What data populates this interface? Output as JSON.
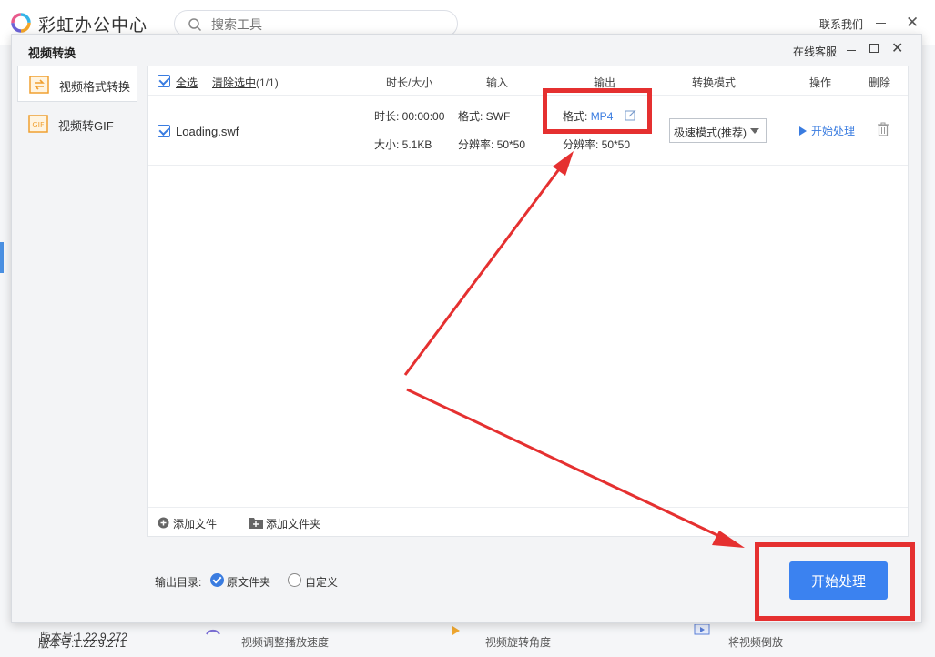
{
  "background_app": {
    "title": "彩虹办公中心",
    "search_placeholder": "搜索工具",
    "contact_label": "联系我们",
    "version": "版本号:1.22.9.271",
    "tools": [
      {
        "label": "视频调整播放速度",
        "icon": "speed-icon"
      },
      {
        "label": "视频旋转角度",
        "icon": "rotate-icon"
      },
      {
        "label": "将视频倒放",
        "icon": "reverse-icon"
      }
    ]
  },
  "dialog": {
    "title": "视频转换",
    "service_label": "在线客服",
    "sidebar": [
      {
        "label": "视频格式转换",
        "icon": "video-convert-icon",
        "active": true
      },
      {
        "label": "视频转GIF",
        "icon": "gif-icon",
        "active": false
      }
    ],
    "version": "版本号:1.22.9.272",
    "table": {
      "select_all": "全选",
      "clear_selected": "清除选中",
      "selected_count": "(1/1)",
      "headers": {
        "duration_size": "时长/大小",
        "input": "输入",
        "output": "输出",
        "mode": "转换模式",
        "action": "操作",
        "delete": "删除"
      },
      "rows": [
        {
          "file_name": "Loading.swf",
          "duration": "时长: 00:00:00",
          "size": "大小: 5.1KB",
          "input_format": "格式: SWF",
          "input_resolution": "分辨率: 50*50",
          "output_format_label": "格式:",
          "output_format_value": "MP4",
          "output_resolution": "分辨率: 50*50",
          "mode": "极速模式(推荐)",
          "action": "开始处理"
        }
      ]
    },
    "add_file": "添加文件",
    "add_folder": "添加文件夹",
    "output_dir_label": "输出目录:",
    "output_options": [
      {
        "label": "原文件夹",
        "selected": true
      },
      {
        "label": "自定义",
        "selected": false
      }
    ],
    "start_button": "开始处理"
  },
  "annotation_color": "#e53030",
  "accent_color": "#3a7ce0"
}
